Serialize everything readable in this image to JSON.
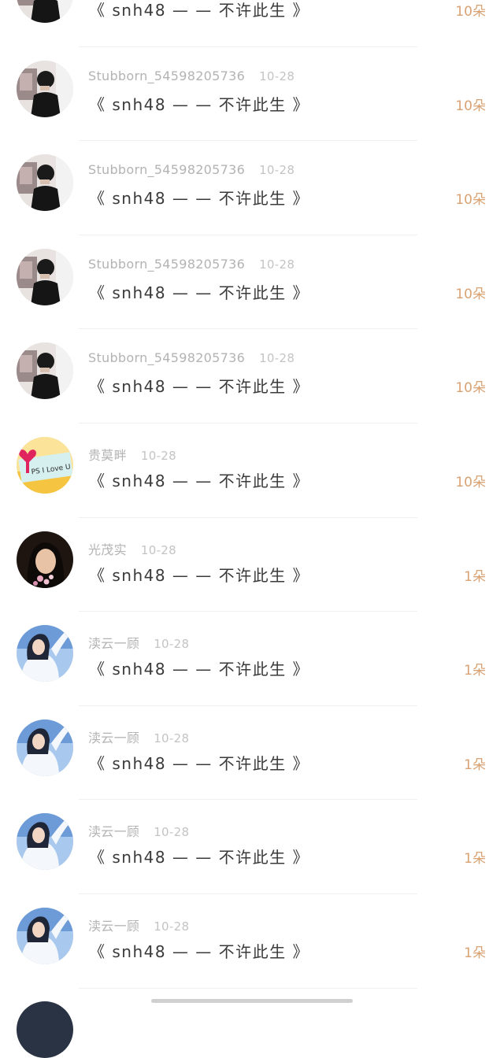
{
  "messages": [
    {
      "avatar": "dark-person-avatar",
      "name": "",
      "date": "",
      "text": "《 snh48 — — 不许此生 》",
      "count": "10朵"
    },
    {
      "avatar": "dark-person-avatar",
      "name": "Stubborn_54598205736",
      "date": "10-28",
      "text": "《 snh48 — — 不许此生 》",
      "count": "10朵"
    },
    {
      "avatar": "dark-person-avatar",
      "name": "Stubborn_54598205736",
      "date": "10-28",
      "text": "《 snh48 — — 不许此生 》",
      "count": "10朵"
    },
    {
      "avatar": "dark-person-avatar",
      "name": "Stubborn_54598205736",
      "date": "10-28",
      "text": "《 snh48 — — 不许此生 》",
      "count": "10朵"
    },
    {
      "avatar": "dark-person-avatar",
      "name": "Stubborn_54598205736",
      "date": "10-28",
      "text": "《 snh48 — — 不许此生 》",
      "count": "10朵"
    },
    {
      "avatar": "ps-i-love-u-avatar",
      "name": "贵莫畔",
      "date": "10-28",
      "text": "《 snh48 — — 不许此生 》",
      "count": "10朵"
    },
    {
      "avatar": "girl-flowers-avatar",
      "name": "光茂实",
      "date": "10-28",
      "text": "《 snh48 — — 不许此生 》",
      "count": "1朵"
    },
    {
      "avatar": "girl-blue-avatar",
      "name": "渎云一顾",
      "date": "10-28",
      "text": "《 snh48 — — 不许此生 》",
      "count": "1朵"
    },
    {
      "avatar": "girl-blue-avatar",
      "name": "渎云一顾",
      "date": "10-28",
      "text": "《 snh48 — — 不许此生 》",
      "count": "1朵"
    },
    {
      "avatar": "girl-blue-avatar",
      "name": "渎云一顾",
      "date": "10-28",
      "text": "《 snh48 — — 不许此生 》",
      "count": "1朵"
    },
    {
      "avatar": "girl-blue-avatar",
      "name": "渎云一顾",
      "date": "10-28",
      "text": "《 snh48 — — 不许此生 》",
      "count": "1朵"
    }
  ],
  "avatar_labels": {
    "ps_card": "PS I Love U"
  },
  "colors": {
    "name": "#b3b3b3",
    "message": "#3a3a3a",
    "count": "#d9a273"
  }
}
